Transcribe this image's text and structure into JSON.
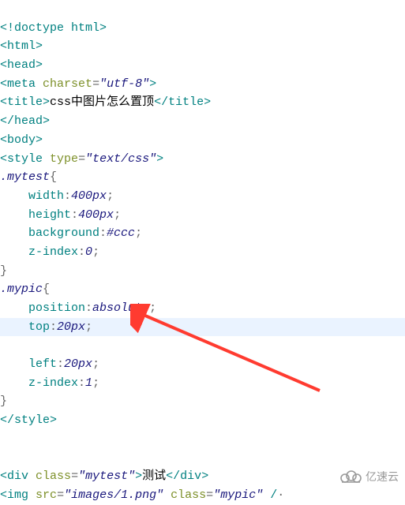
{
  "code": {
    "doctype": {
      "open": "<!",
      "name": "doctype html",
      "close": ">"
    },
    "html_open": {
      "open": "<",
      "name": "html",
      "close": ">"
    },
    "head_open": {
      "open": "<",
      "name": "head",
      "close": ">"
    },
    "meta": {
      "open": "<",
      "name": "meta",
      "sp": " ",
      "attr_name": "charset",
      "eq": "=",
      "val_open": "\"",
      "val": "utf-8",
      "val_close": "\"",
      "close": ">"
    },
    "title": {
      "open": "<",
      "name": "title",
      "close": ">",
      "text": "css中图片怎么置顶",
      "end_open": "</",
      "end_name": "title",
      "end_close": ">"
    },
    "head_close": {
      "open": "</",
      "name": "head",
      "close": ">"
    },
    "body_open": {
      "open": "<",
      "name": "body",
      "close": ">"
    },
    "style_open": {
      "open": "<",
      "name": "style",
      "sp": " ",
      "attr_name": "type",
      "eq": "=",
      "val_open": "\"",
      "val": "text/css",
      "val_close": "\"",
      "close": ">"
    },
    "mytest": {
      "sel": ".mytest",
      "brace_open": "{",
      "p1": "width",
      "c1": ":",
      "v1": "400px",
      "s1": ";",
      "p2": "height",
      "c2": ":",
      "v2": "400px",
      "s2": ";",
      "p3": "background",
      "c3": ":",
      "v3": "#ccc",
      "s3": ";",
      "p4": "z-index",
      "c4": ":",
      "v4": "0",
      "s4": ";",
      "brace_close": "}"
    },
    "mypic": {
      "sel": ".mypic",
      "brace_open": "{",
      "p1": "position",
      "c1": ":",
      "v1": "absolute",
      "s1": ";",
      "p2": "top",
      "c2": ":",
      "v2": "20px",
      "s2": ";",
      "p3": "left",
      "c3": ":",
      "v3": "20px",
      "s3": ";",
      "p4": "z-index",
      "c4": ":",
      "v4": "1",
      "s4": ";",
      "brace_close": "}"
    },
    "style_close": {
      "open": "</",
      "name": "style",
      "close": ">"
    },
    "indent": "    ",
    "blank": "",
    "div": {
      "open": "<",
      "name": "div",
      "sp": " ",
      "attr": "class",
      "eq": "=",
      "vo": "\"",
      "val": "mytest",
      "vc": "\"",
      "close": ">",
      "text": "测试",
      "end_open": "</",
      "end_name": "div",
      "end_close": ">"
    },
    "img": {
      "open": "<",
      "name": "img",
      "sp1": " ",
      "attr1": "src",
      "eq1": "=",
      "v1o": "\"",
      "v1": "images/1.png",
      "v1c": "\"",
      "sp2": " ",
      "attr2": "class",
      "eq2": "=",
      "v2o": "\"",
      "v2": "mypic",
      "v2c": "\"",
      "sp3": " ",
      "slash": "/",
      "tail": "·"
    }
  },
  "watermark": {
    "text": "亿速云"
  },
  "colors": {
    "arrow": "#ff3b30"
  }
}
